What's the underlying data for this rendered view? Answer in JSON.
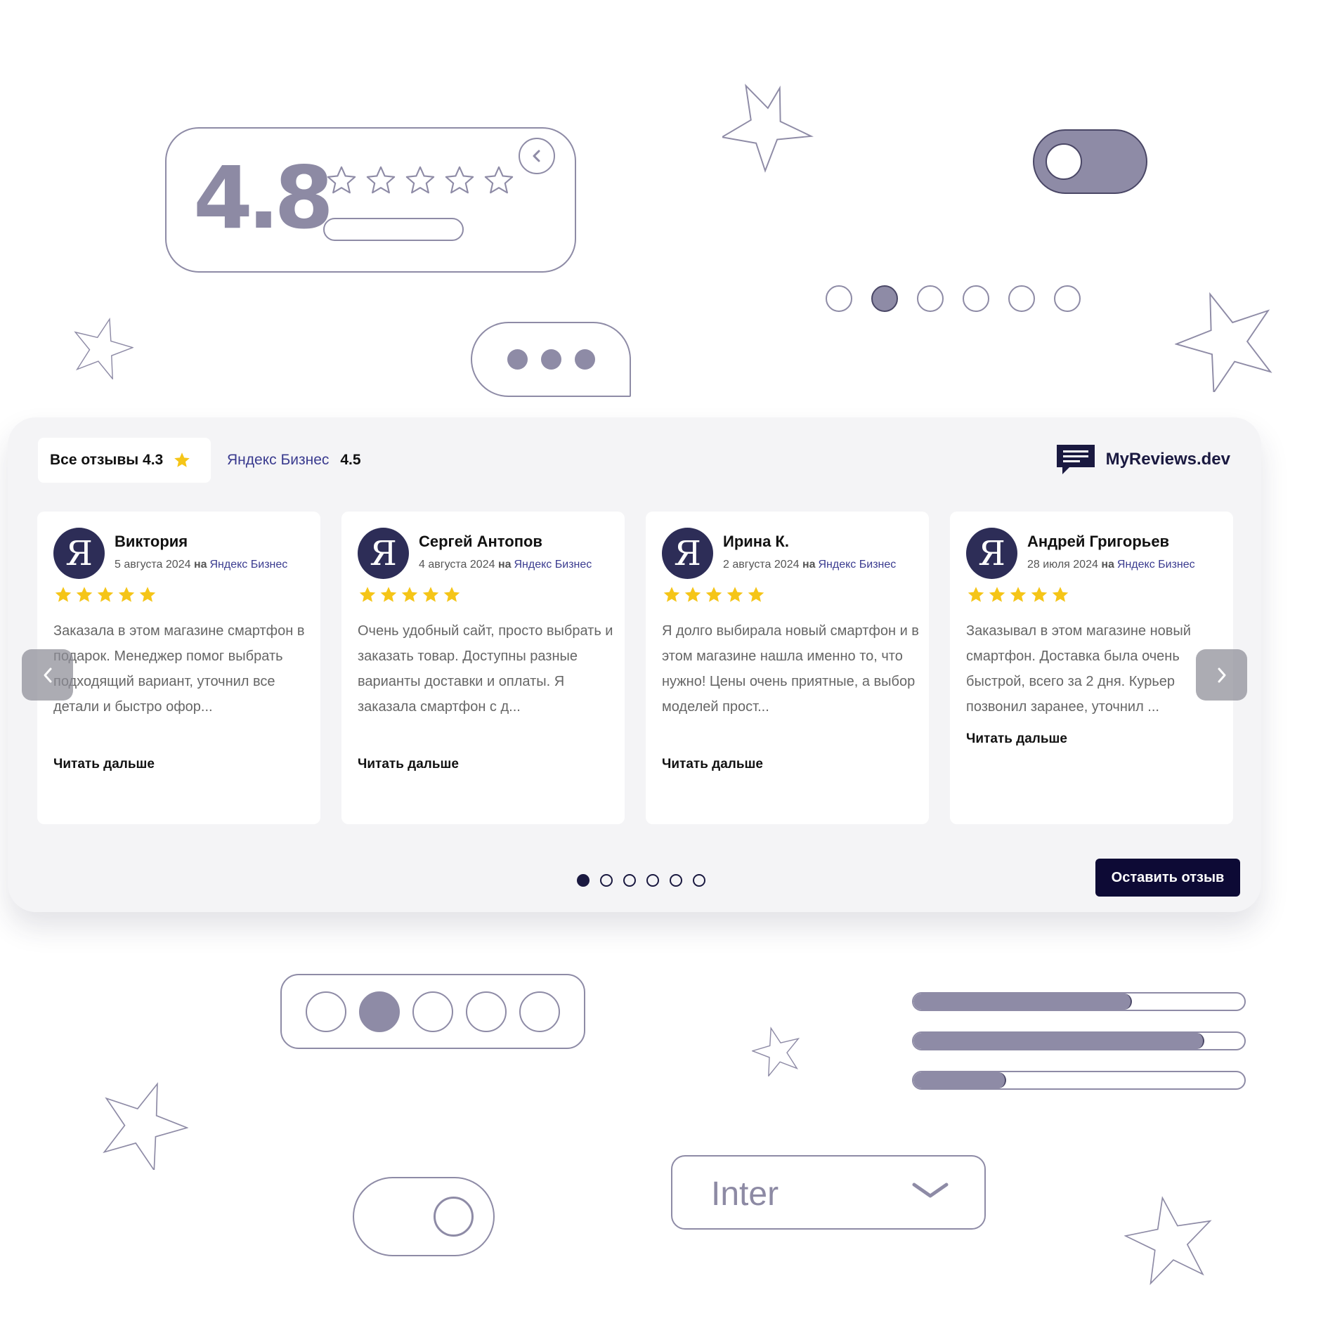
{
  "rating_card": {
    "score": "4.8",
    "stars_filled": 0,
    "stars_total": 5,
    "icons": [
      "star-outline-icon",
      "chevron-left-icon"
    ]
  },
  "toggle_top": {
    "state": "on"
  },
  "dots_top": {
    "count": 6,
    "active_index": 1
  },
  "typing_bubble": {
    "dots": 3
  },
  "widget": {
    "tabs": {
      "all_label": "Все отзывы",
      "all_rating": "4.3",
      "yandex_label": "Яндекс Бизнес",
      "yandex_rating": "4.5"
    },
    "brand": {
      "name": "MyReviews.dev",
      "icon": "chat-lines-icon"
    },
    "on_word": "на",
    "read_more": "Читать дальше",
    "leave_review": "Оставить отзыв",
    "reviews": [
      {
        "avatar": "Я",
        "author": "Виктория",
        "date": "5 августа 2024",
        "source": "Яндекс Бизнес",
        "stars": 5,
        "text": "Заказала в этом магазине смартфон в подарок. Менеджер помог выбрать подходящий вариант, уточнил все детали и быстро офор..."
      },
      {
        "avatar": "Я",
        "author": "Сергей Антопов",
        "date": "4 августа 2024",
        "source": "Яндекс Бизнес",
        "stars": 5,
        "text": "Очень удобный сайт, просто выбрать и заказать товар. Доступны разные варианты доставки и оплаты. Я заказала смартфон с д..."
      },
      {
        "avatar": "Я",
        "author": "Ирина К.",
        "date": "2 августа 2024",
        "source": "Яндекс Бизнес",
        "stars": 5,
        "text": "Я долго выбирала новый смартфон и в этом магазине нашла именно то, что нужно! Цены очень приятные, а выбор моделей прост..."
      },
      {
        "avatar": "Я",
        "author": "Андрей Григорьев",
        "date": "28 июля 2024",
        "source": "Яндекс Бизнес",
        "stars": 5,
        "text": "Заказывал в этом магазине новый смартфон. Доставка была очень быстрой, всего за 2 дня. Курьер позвонил заранее, уточнил ..."
      }
    ],
    "pager": {
      "count": 6,
      "active_index": 0
    },
    "colors": {
      "accent": "#0d0a35",
      "star": "#f5c518",
      "source_link": "#3a3b8f"
    }
  },
  "circles_box": {
    "count": 5,
    "active_index": 1
  },
  "progress_bars": [
    0.66,
    0.88,
    0.28
  ],
  "toggle_bottom": {
    "state": "off"
  },
  "font_select": {
    "value": "Inter",
    "icon": "chevron-down-icon"
  },
  "colors": {
    "outline": "#8e8ba6",
    "outline_dark": "#4a4766"
  }
}
